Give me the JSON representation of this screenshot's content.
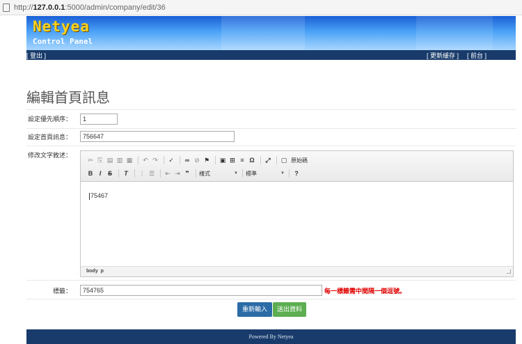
{
  "browser": {
    "url_prefix": "http://",
    "url_host": "127.0.0.1",
    "url_path": ":5000/admin/company/edit/36"
  },
  "header": {
    "brand": "Netyea",
    "subtitle": "Control Panel"
  },
  "nav": {
    "logout": "[ 登出 ]",
    "refresh_cache": "[ 更新緩存 ]",
    "frontend": "[ 前台 ]"
  },
  "page": {
    "title": "編輯首頁訊息"
  },
  "form": {
    "priority_label": "設定優先順序：",
    "priority_value": "1",
    "message_label": "設定首頁訊息：",
    "message_value": "756647",
    "content_label": "修改文字敘述：",
    "content_value": "75467",
    "tags_label": "標籤：",
    "tags_value": "754765",
    "tags_hint": "每一標籤需中間隔一個逗號。",
    "reset_button": "重新輸入",
    "submit_button": "送出資料"
  },
  "editor": {
    "source_label": "原始碼",
    "styles_combo": "樣式",
    "format_combo": "標準",
    "path_body": "body",
    "path_p": "p"
  },
  "footer": {
    "text": "Powered By Netyea"
  },
  "colors": {
    "navbar": "#183b6b",
    "reset_button": "#2b6ba6",
    "submit_button": "#5cae51",
    "hint_text": "#e00000",
    "brand_text": "#ffd21a"
  }
}
